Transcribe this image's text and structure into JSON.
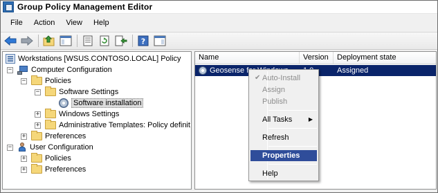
{
  "window": {
    "title": "Group Policy Management Editor"
  },
  "menubar": [
    "File",
    "Action",
    "View",
    "Help"
  ],
  "toolbar": {
    "icons": [
      "back-arrow-icon",
      "forward-arrow-icon",
      "up-folder-icon",
      "show-hide-tree-icon",
      "properties-icon",
      "refresh-icon",
      "export-list-icon",
      "help-icon",
      "show-hide-action-pane-icon"
    ]
  },
  "tree": {
    "root": "Workstations [WSUS.CONTOSO.LOCAL] Policy",
    "computer_configuration": "Computer Configuration",
    "cc_policies": "Policies",
    "software_settings": "Software Settings",
    "software_installation": "Software installation",
    "windows_settings": "Windows Settings",
    "admin_templates": "Administrative Templates: Policy definit",
    "cc_preferences": "Preferences",
    "user_configuration": "User Configuration",
    "uc_policies": "Policies",
    "uc_preferences": "Preferences"
  },
  "list": {
    "columns": [
      "Name",
      "Version",
      "Deployment state"
    ],
    "rows": [
      {
        "name": "Geosense for Windows",
        "version": "1.0",
        "state": "Assigned"
      }
    ]
  },
  "context_menu": {
    "auto_install": "Auto-Install",
    "assign": "Assign",
    "publish": "Publish",
    "all_tasks": "All Tasks",
    "refresh": "Refresh",
    "properties": "Properties",
    "help": "Help"
  },
  "colors": {
    "selection": "#0a246a",
    "menu_highlight": "#2f4d9a",
    "disabled_text": "#8d8d8d"
  }
}
